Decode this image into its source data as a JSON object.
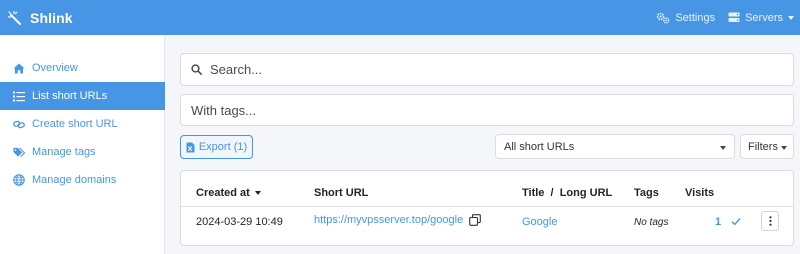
{
  "brand": {
    "name": "Shlink",
    "icon": "magic-wand-icon"
  },
  "topnav": {
    "settings_label": "Settings",
    "servers_label": "Servers"
  },
  "sidebar": {
    "items": [
      {
        "label": "Overview",
        "icon": "home-icon",
        "active": false
      },
      {
        "label": "List short URLs",
        "icon": "list-icon",
        "active": true
      },
      {
        "label": "Create short URL",
        "icon": "link-icon",
        "active": false
      },
      {
        "label": "Manage tags",
        "icon": "tags-icon",
        "active": false
      },
      {
        "label": "Manage domains",
        "icon": "globe-icon",
        "active": false
      }
    ]
  },
  "search": {
    "placeholder": "Search..."
  },
  "tags_filter": {
    "placeholder": "With tags..."
  },
  "toolbar": {
    "export_label": "Export (1)",
    "short_urls_select": "All short URLs",
    "filters_label": "Filters"
  },
  "table": {
    "headers": {
      "created_at": "Created at",
      "short_url": "Short URL",
      "title_long_url": "Title  /  Long URL",
      "tags": "Tags",
      "visits": "Visits"
    },
    "rows": [
      {
        "created_at": "2024-03-29 10:49",
        "short_url": "https://myvpsserver.top/google",
        "title": "Google",
        "tags": "No tags",
        "visits": "1"
      }
    ]
  },
  "colors": {
    "primary": "#4696e5",
    "background": "#f5f6fa",
    "text": "#212529"
  }
}
